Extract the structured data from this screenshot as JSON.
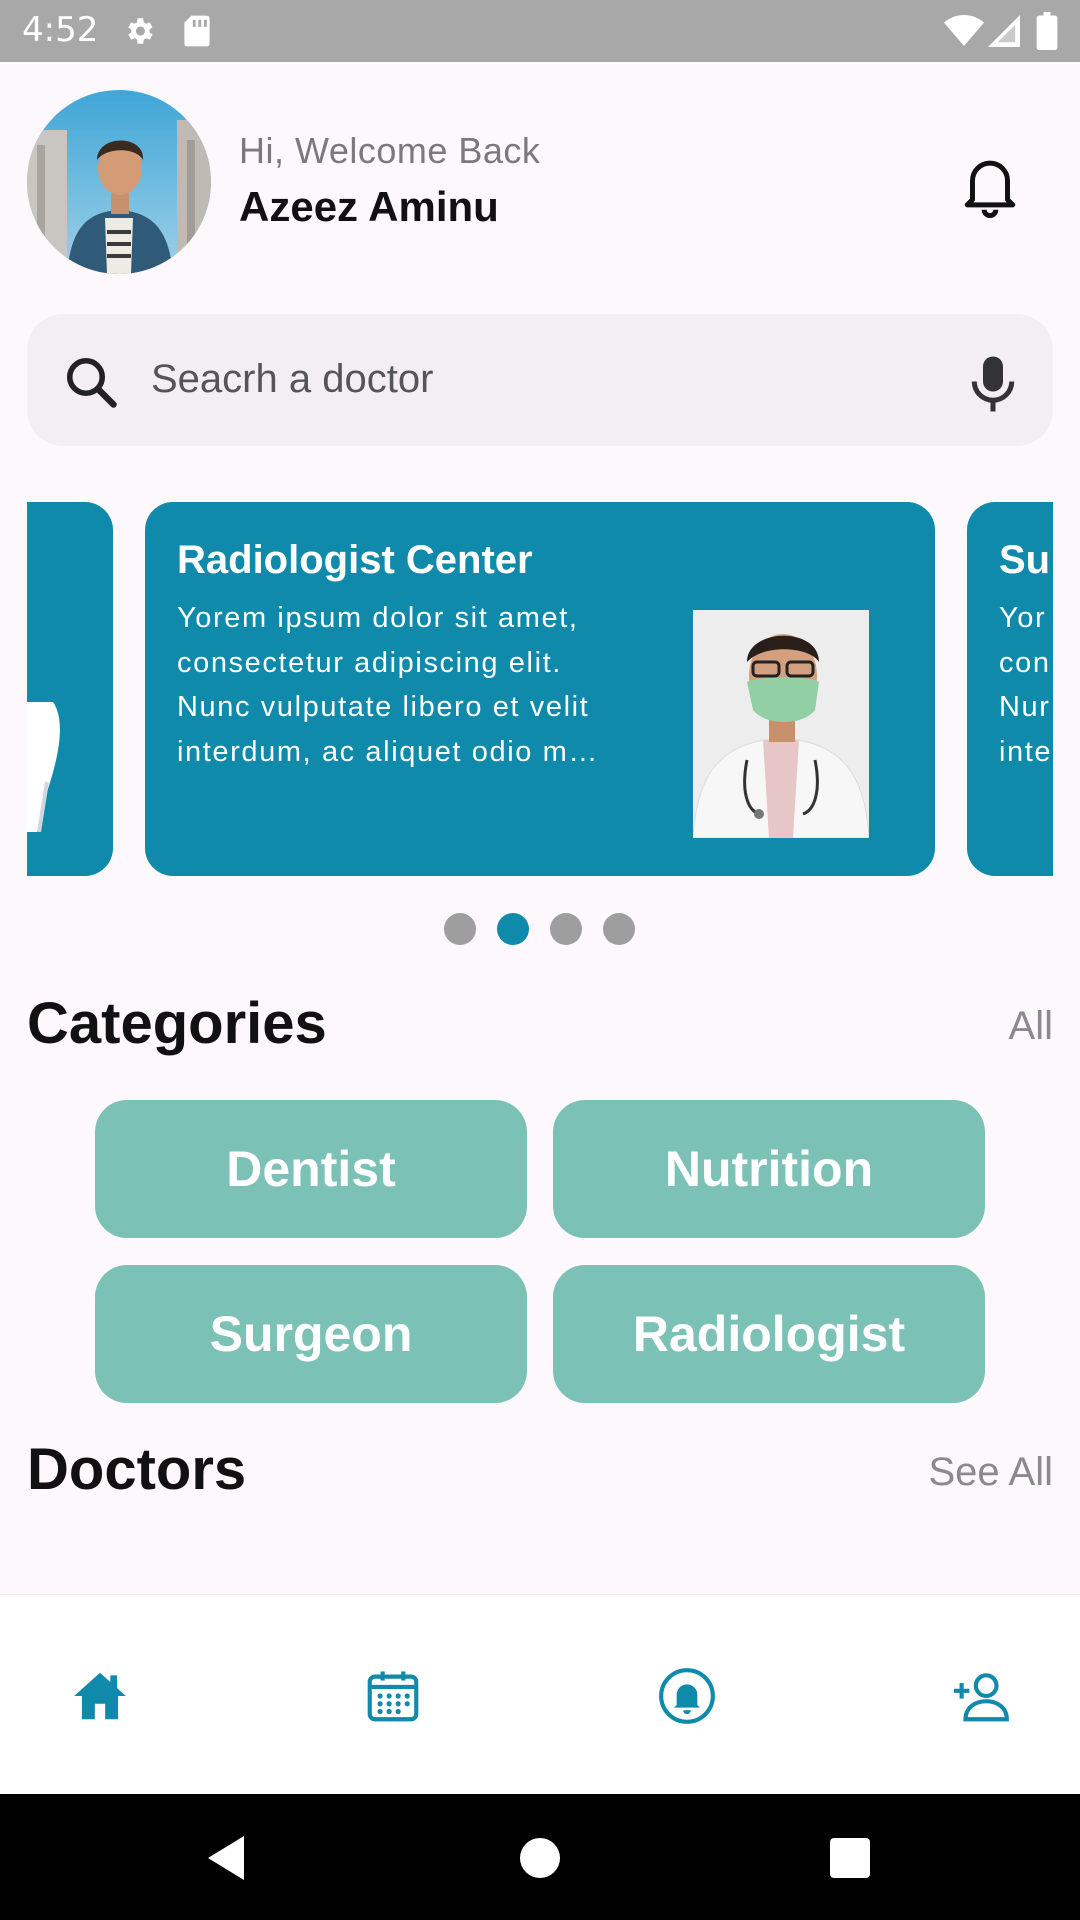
{
  "status_bar": {
    "time": "4:52",
    "icons": [
      "gear-icon",
      "sd-card-icon",
      "wifi-icon",
      "signal-icon",
      "battery-icon"
    ]
  },
  "header": {
    "greeting": "Hi, Welcome Back",
    "user_name": "Azeez Aminu",
    "notification_icon": "bell-icon"
  },
  "search": {
    "placeholder": "Seacrh a doctor",
    "value": "",
    "leading_icon": "search-icon",
    "trailing_icon": "mic-icon"
  },
  "carousel": {
    "cards": [
      {
        "title": "Radiologist Center",
        "body_lines": [
          "Yorem ipsum dolor sit amet,",
          "consectetur adipiscing elit.",
          "Nunc vulputate libero et velit",
          "interdum, ac aliquet odio m…"
        ]
      },
      {
        "title": "Su",
        "body_lines": [
          "Yor",
          "con",
          "Nur",
          "inte"
        ]
      }
    ],
    "page_count": 4,
    "active_index": 1
  },
  "categories": {
    "title": "Categories",
    "link": "All",
    "items": [
      "Dentist",
      "Nutrition",
      "Surgeon",
      "Radiologist"
    ]
  },
  "doctors": {
    "title": "Doctors",
    "link": "See All"
  },
  "bottom_nav": {
    "items": [
      "home-icon",
      "calendar-icon",
      "notification-icon",
      "profile-icon"
    ]
  },
  "colors": {
    "primary": "#0f8aab",
    "category": "#7cc1b5",
    "dot_inactive": "#9e9e9e"
  }
}
